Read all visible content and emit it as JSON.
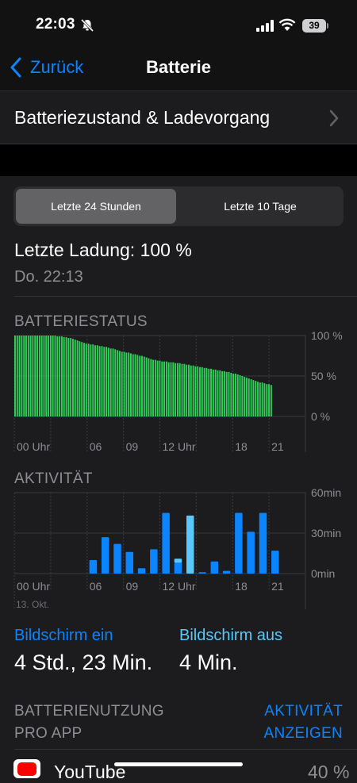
{
  "status": {
    "time": "22:03",
    "battery": "39"
  },
  "nav": {
    "back": "Zurück",
    "title": "Batterie"
  },
  "health": {
    "label": "Batteriezustand & Ladevorgang"
  },
  "segmented": {
    "left": "Letzte 24 Stunden",
    "right": "Letzte 10 Tage",
    "selected": "left"
  },
  "last_charge": {
    "label": "Letzte Ladung: 100 %",
    "time": "Do. 22:13"
  },
  "battery_level": {
    "title": "BATTERIESTATUS"
  },
  "activity": {
    "title": "AKTIVITÄT"
  },
  "screen": {
    "on_label": "Bildschirm ein",
    "on_value": "4 Std., 23 Min.",
    "off_label": "Bildschirm aus",
    "off_value": "4 Min."
  },
  "usage": {
    "title_line1": "BATTERIENUTZUNG",
    "title_line2": "PRO APP",
    "action_line1": "AKTIVITÄT",
    "action_line2": "ANZEIGEN"
  },
  "apps": [
    {
      "name": "YouTube",
      "percent": "40 %"
    }
  ],
  "colors": {
    "accent": "#0a84ff",
    "battery_green": "#30d158",
    "screen_on": "#0a84ff",
    "screen_off": "#5ac8fa"
  },
  "chart_data": [
    {
      "type": "bar",
      "title": "BATTERIESTATUS",
      "x_tick_labels": [
        "00 Uhr",
        "06",
        "09",
        "12 Uhr",
        "18",
        "21"
      ],
      "y_tick_labels": [
        "100 %",
        "50 %",
        "0 %"
      ],
      "ylim": [
        0,
        100
      ],
      "values": [
        100,
        100,
        100,
        100,
        100,
        100,
        100,
        100,
        100,
        100,
        100,
        100,
        100,
        100,
        100,
        100,
        100,
        100,
        100,
        99,
        99,
        99,
        98,
        98,
        97,
        97,
        96,
        95,
        94,
        93,
        92,
        91,
        90,
        90,
        89,
        89,
        88,
        88,
        87,
        87,
        86,
        86,
        85,
        84,
        84,
        83,
        82,
        81,
        80,
        80,
        79,
        79,
        78,
        77,
        77,
        76,
        75,
        75,
        74,
        73,
        72,
        71,
        70,
        70,
        69,
        69,
        68,
        68,
        68,
        67,
        67,
        67,
        66,
        66,
        66,
        65,
        65,
        64,
        64,
        63,
        63,
        62,
        62,
        61,
        61,
        60,
        60,
        59,
        59,
        58,
        58,
        57,
        57,
        56,
        56,
        55,
        55,
        54,
        53,
        53,
        52,
        51,
        50,
        49,
        48,
        47,
        46,
        45,
        44,
        43,
        42,
        42,
        41,
        40,
        40,
        39
      ]
    },
    {
      "type": "bar",
      "title": "AKTIVITÄT",
      "x_tick_labels": [
        "00 Uhr",
        "06",
        "09",
        "12 Uhr",
        "18",
        "21"
      ],
      "date_label": "13. Okt.",
      "y_tick_labels": [
        "60min",
        "30min",
        "0min"
      ],
      "ylim": [
        0,
        60
      ],
      "categories": [
        "00",
        "01",
        "02",
        "03",
        "04",
        "05",
        "06",
        "07",
        "08",
        "09",
        "10",
        "11",
        "12",
        "13",
        "14",
        "15",
        "16",
        "17",
        "18",
        "19",
        "20",
        "21",
        "22",
        "23"
      ],
      "series": [
        {
          "name": "Bildschirm ein",
          "values": [
            0,
            0,
            0,
            0,
            0,
            0,
            10,
            27,
            22,
            16,
            4,
            18,
            45,
            8,
            0,
            1,
            9,
            2,
            45,
            31,
            45,
            17,
            0,
            0
          ]
        },
        {
          "name": "Bildschirm aus",
          "values": [
            0,
            0,
            0,
            0,
            0,
            0,
            0,
            0,
            0,
            0,
            0,
            0,
            0,
            3,
            43,
            0,
            0,
            0,
            0,
            0,
            0,
            0,
            0,
            0
          ]
        }
      ]
    }
  ]
}
